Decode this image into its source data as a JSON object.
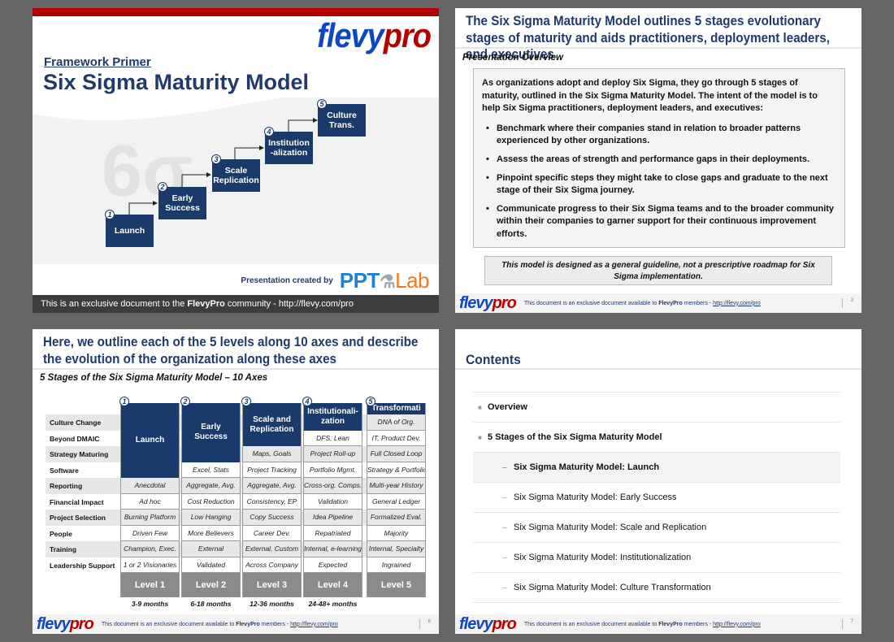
{
  "slide1": {
    "logo": {
      "part1": "flevy",
      "part2": "pro"
    },
    "kicker": "Framework Primer",
    "title": "Six Sigma Maturity Model",
    "watermark": "6σ",
    "steps": [
      {
        "num": "1",
        "label": "Launch"
      },
      {
        "num": "2",
        "label": "Early Success"
      },
      {
        "num": "3",
        "label": "Scale Replication"
      },
      {
        "num": "4",
        "label": "Institution-alization"
      },
      {
        "num": "5",
        "label": "Culture Trans."
      }
    ],
    "credit": {
      "text": "Presentation created by",
      "brand1": "PPT",
      "brand2": "Lab"
    },
    "footer": {
      "pre": "This is an exclusive document to the ",
      "bold": "FlevyPro",
      "post": " community - http://flevy.com/pro"
    }
  },
  "slide2": {
    "title": "The Six Sigma Maturity Model outlines 5 stages evolutionary stages of maturity and aids practitioners, deployment leaders, and executives",
    "subtitle": "Presentation Overview",
    "intro": "As organizations adopt and deploy Six Sigma, they go through 5 stages of maturity, outlined in the Six Sigma Maturity Model. The intent of the model is to help Six Sigma practitioners, deployment leaders, and executives:",
    "bullets": [
      "Benchmark where their companies stand in relation to broader patterns experienced by other organizations.",
      "Assess the areas of strength and performance gaps in their deployments.",
      "Pinpoint specific steps they might take to close gaps and graduate to the next stage of their Six Sigma journey.",
      "Communicate progress to their Six Sigma teams and to the broader community within their companies to garner support for their continuous improvement efforts."
    ],
    "note": "This model is designed as a general guideline, not a prescriptive roadmap for Six Sigma implementation.",
    "page": "3"
  },
  "slide3": {
    "title": "Here, we outline each of the 5 levels along 10 axes and describe the evolution of the organization along these axes",
    "subtitle": "5 Stages of the Six Sigma Maturity Model – 10 Axes",
    "axes": [
      "Culture Change",
      "Beyond DMAIC",
      "Strategy Maturing",
      "Software",
      "Reporting",
      "Financial Impact",
      "Project Selection",
      "People",
      "Training",
      "Leadership Support"
    ],
    "stages": [
      {
        "num": "1",
        "name": "Launch",
        "level": "Level 1",
        "duration": "3-9 months",
        "values": [
          "Anecdotal",
          "Ad hoc",
          "Burning Platform",
          "Driven Few",
          "Champion, Exec.",
          "1 or 2 Visionaries"
        ]
      },
      {
        "num": "2",
        "name": "Early Success",
        "level": "Level 2",
        "duration": "6-18 months",
        "values": [
          "Excel, Stats",
          "Aggregate, Avg.",
          "Cost Reduction",
          "Low Hanging",
          "More Believers",
          "External",
          "Validated"
        ]
      },
      {
        "num": "3",
        "name": "Scale and Replication",
        "level": "Level 3",
        "duration": "12-36 months",
        "values": [
          "Maps, Goals",
          "Project Tracking",
          "Aggregate, Avg.",
          "Consistency, EP",
          "Copy Success",
          "Career Dev.",
          "External, Custom",
          "Across Company"
        ]
      },
      {
        "num": "4",
        "name": "Institutionali-zation",
        "level": "Level 4",
        "duration": "24-48+ months",
        "values": [
          "DFS, Lean",
          "Project Roll-up",
          "Portfolio Mgmt.",
          "Cross-org. Comps.",
          "Validation",
          "Idea Pipeline",
          "Repatriated",
          "Internal, e-learning",
          "Expected"
        ]
      },
      {
        "num": "5",
        "name": "Culture Transformation",
        "level": "Level 5",
        "duration": "",
        "values": [
          "DNA of Org.",
          "IT, Product Dev.",
          "Full Closed Loop",
          "Strategy & Portfolio",
          "Multi-year History",
          "General Ledger",
          "Formalized Eval.",
          "Majority",
          "Internal, Specialty",
          "Ingrained"
        ]
      }
    ],
    "page": "6"
  },
  "slide4": {
    "title": "Contents",
    "items": [
      {
        "level": 1,
        "label": "Overview",
        "active": false
      },
      {
        "level": 1,
        "label": "5 Stages of the Six Sigma Maturity Model",
        "active": false
      },
      {
        "level": 2,
        "label": "Six Sigma Maturity Model: Launch",
        "active": true
      },
      {
        "level": 2,
        "label": "Six Sigma Maturity Model: Early Success",
        "active": false
      },
      {
        "level": 2,
        "label": "Six Sigma Maturity Model: Scale and Replication",
        "active": false
      },
      {
        "level": 2,
        "label": "Six Sigma Maturity Model: Institutionalization",
        "active": false
      },
      {
        "level": 2,
        "label": "Six Sigma Maturity Model: Culture Transformation",
        "active": false
      }
    ],
    "page": "7"
  },
  "footer": {
    "pre": "This document is an exclusive document available to ",
    "bold": "FlevyPro",
    "mid": " members - ",
    "link": "http://flevy.com/pro"
  },
  "colors": {
    "navy": "#1a3a6b",
    "red": "#b30000",
    "blue": "#0d47c7",
    "level_gray": "#8b8b8b"
  }
}
